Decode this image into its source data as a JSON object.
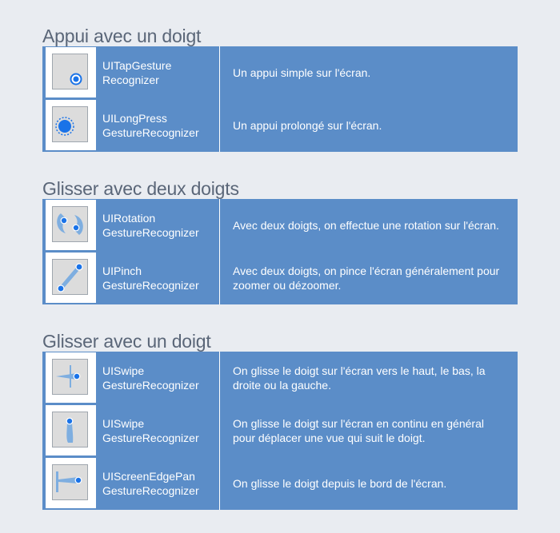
{
  "sections": [
    {
      "title": "Appui avec un doigt",
      "rows": [
        {
          "icon": "tap-icon",
          "name_line1": "UITapGesture",
          "name_line2": "Recognizer",
          "description": "Un appui simple sur l'écran."
        },
        {
          "icon": "long-press-icon",
          "name_line1": "UILongPress",
          "name_line2": "GestureRecognizer",
          "description": "Un appui prolongé sur l'écran."
        }
      ]
    },
    {
      "title": "Glisser avec deux doigts",
      "rows": [
        {
          "icon": "rotation-icon",
          "name_line1": "UIRotation",
          "name_line2": "GestureRecognizer",
          "description": "Avec deux doigts, on effectue une rotation sur l'écran."
        },
        {
          "icon": "pinch-icon",
          "name_line1": "UIPinch",
          "name_line2": "GestureRecognizer",
          "description": "Avec deux doigts, on pince l'écran généralement pour zoomer ou dézoomer."
        }
      ]
    },
    {
      "title": "Glisser avec un doigt",
      "rows": [
        {
          "icon": "swipe-icon",
          "name_line1": "UISwipe",
          "name_line2": "GestureRecognizer",
          "description": "On glisse le doigt sur l'écran vers le haut, le bas, la droite ou la gauche."
        },
        {
          "icon": "pan-icon",
          "name_line1": "UISwipe",
          "name_line2": "GestureRecognizer",
          "description": "On glisse le doigt sur l'écran en continu en général pour déplacer une vue qui suit le doigt."
        },
        {
          "icon": "screen-edge-pan-icon",
          "name_line1": "UIScreenEdgePan",
          "name_line2": "GestureRecognizer",
          "description": "On glisse le doigt depuis le bord de l'écran."
        }
      ]
    }
  ],
  "colors": {
    "background": "#e9ecf1",
    "table": "#5b8dc8",
    "title": "#5a6678",
    "touch_point": "#1a73e8"
  }
}
